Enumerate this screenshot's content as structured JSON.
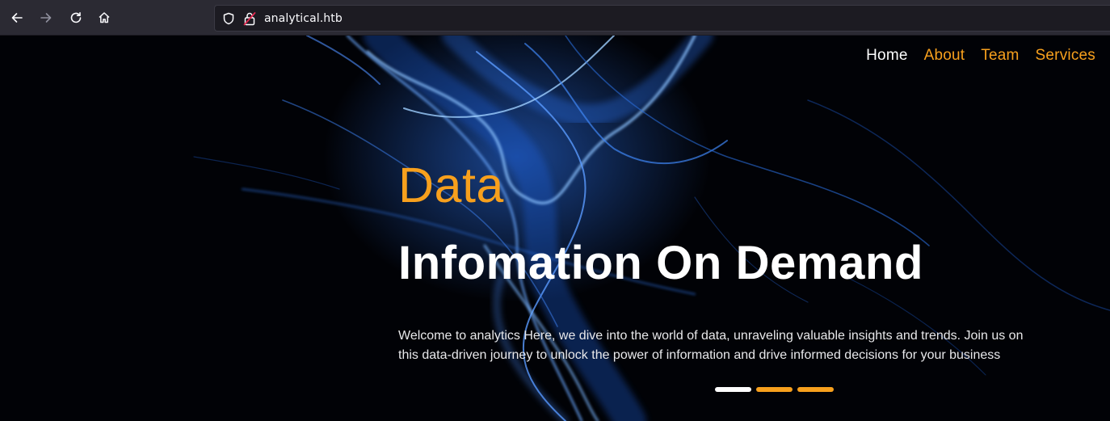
{
  "browser": {
    "url": "analytical.htb",
    "back_icon": "arrow-left-icon",
    "forward_icon": "arrow-right-icon",
    "reload_icon": "reload-icon",
    "home_icon": "home-icon",
    "shield_icon": "shield-icon",
    "lock_icon": "insecure-lock-icon"
  },
  "site": {
    "nav": [
      {
        "label": "Home",
        "active": true
      },
      {
        "label": "About",
        "active": false
      },
      {
        "label": "Team",
        "active": false
      },
      {
        "label": "Services",
        "active": false
      }
    ],
    "hero": {
      "kicker": "Data",
      "headline": "Infomation On Demand",
      "intro": "Welcome to analytics Here, we dive into the world of data, unraveling valuable insights and trends. Join us on this data-driven journey to unlock the power of information and drive informed decisions for your business"
    },
    "carousel": {
      "slide_count": 3,
      "active_index": 0
    },
    "colors": {
      "accent": "#f7a01d",
      "text": "#ffffff",
      "background": "#010206",
      "smoke": "#3a8cff"
    }
  }
}
